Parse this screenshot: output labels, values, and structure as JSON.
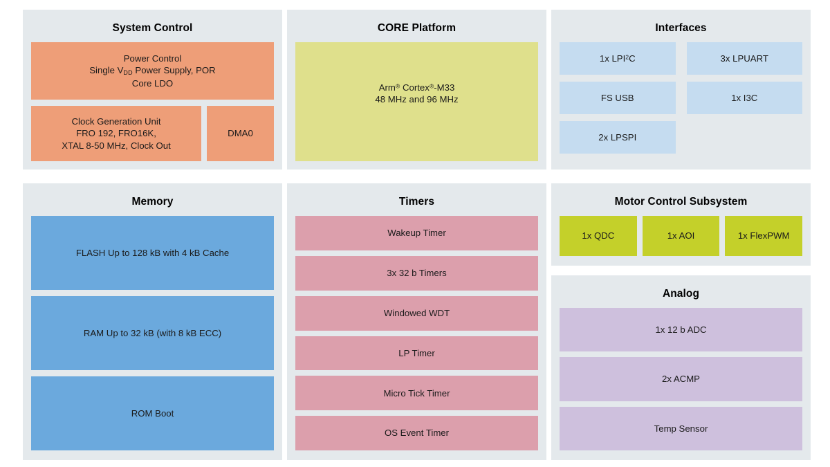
{
  "panels": {
    "system_control": {
      "title": "System Control",
      "power_control": {
        "line1": "Power Control",
        "line2_pre": "Single V",
        "line2_sub": "DD",
        "line2_post": " Power Supply, POR",
        "line3": "Core LDO"
      },
      "clock_generation": {
        "line1": "Clock Generation Unit",
        "line2": "FRO 192, FRO16K,",
        "line3": "XTAL 8-50 MHz, Clock Out"
      },
      "dma": "DMA0"
    },
    "core_platform": {
      "title": "CORE Platform",
      "core": {
        "line1_pre": "Arm",
        "line1_sup1": "®",
        "line1_mid": " Cortex",
        "line1_sup2": "®",
        "line1_post": "-M33",
        "line2": "48 MHz and 96 MHz"
      }
    },
    "interfaces": {
      "title": "Interfaces",
      "items": [
        {
          "pre": "1x LPI",
          "sup": "2",
          "post": "C"
        },
        {
          "pre": "3x LPUART",
          "sup": "",
          "post": ""
        },
        {
          "pre": "FS USB",
          "sup": "",
          "post": ""
        },
        {
          "pre": "1x I3C",
          "sup": "",
          "post": ""
        },
        {
          "pre": "2x LPSPI",
          "sup": "",
          "post": ""
        }
      ]
    },
    "memory": {
      "title": "Memory",
      "items": [
        "FLASH Up to 128 kB with 4 kB Cache",
        "RAM Up to 32 kB (with 8 kB ECC)",
        "ROM Boot"
      ]
    },
    "timers": {
      "title": "Timers",
      "items": [
        "Wakeup Timer",
        "3x 32 b Timers",
        "Windowed WDT",
        "LP Timer",
        "Micro Tick Timer",
        "OS Event Timer"
      ]
    },
    "motor_control": {
      "title": "Motor Control Subsystem",
      "items": [
        "1x QDC",
        "1x AOI",
        "1x FlexPWM"
      ]
    },
    "analog": {
      "title": "Analog",
      "items": [
        "1x 12 b ADC",
        "2x ACMP",
        "Temp Sensor"
      ]
    }
  },
  "colors": {
    "panel_background": "#e4e9ec",
    "system_control_block": "#ee9e78",
    "core_block": "#dfe08c",
    "interfaces_block": "#c5dcf0",
    "memory_block": "#6ba9dd",
    "timers_block": "#dc9fac",
    "motor_control_block": "#c4d02a",
    "analog_block": "#cec0dd",
    "page_background": "#ffffff",
    "text": "#1a1a1a"
  }
}
